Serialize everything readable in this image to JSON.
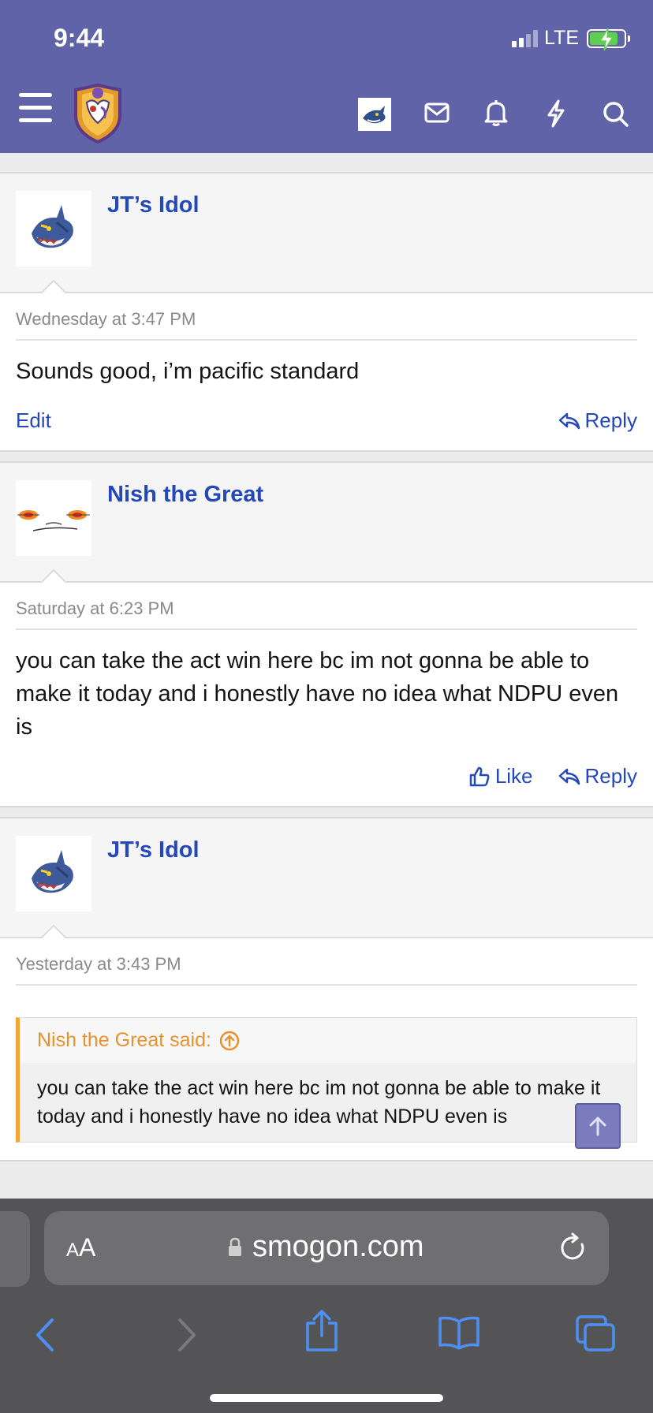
{
  "status_bar": {
    "time": "9:44",
    "network": "LTE"
  },
  "header": {
    "icons": [
      "menu-icon",
      "site-logo",
      "user-avatar",
      "mail-icon",
      "bell-icon",
      "bolt-icon",
      "search-icon"
    ]
  },
  "posts": [
    {
      "username": "JT’s Idol",
      "timestamp": "Wednesday at 3:47 PM",
      "message": "Sounds good, i’m pacific standard",
      "edit_label": "Edit",
      "reply_label": "Reply"
    },
    {
      "username": "Nish the Great",
      "timestamp": "Saturday at 6:23 PM",
      "message": "you can take the act win here bc im not gonna be able to make it today and i honestly have no idea what NDPU even is",
      "like_label": "Like",
      "reply_label": "Reply"
    },
    {
      "username": "JT’s Idol",
      "timestamp": "Yesterday at 3:43 PM",
      "quote_author": "Nish the Great said:",
      "quote_text": "you can take the act win here bc im not gonna be able to make it today and i honestly have no idea what NDPU even is"
    }
  ],
  "browser": {
    "aa_big": "A",
    "aa_small": "A",
    "domain": "smogon.com"
  },
  "colors": {
    "header_bg": "#6163a9",
    "link": "#2548b8",
    "quote_accent": "#f4a533",
    "browser_bg": "#545456"
  }
}
